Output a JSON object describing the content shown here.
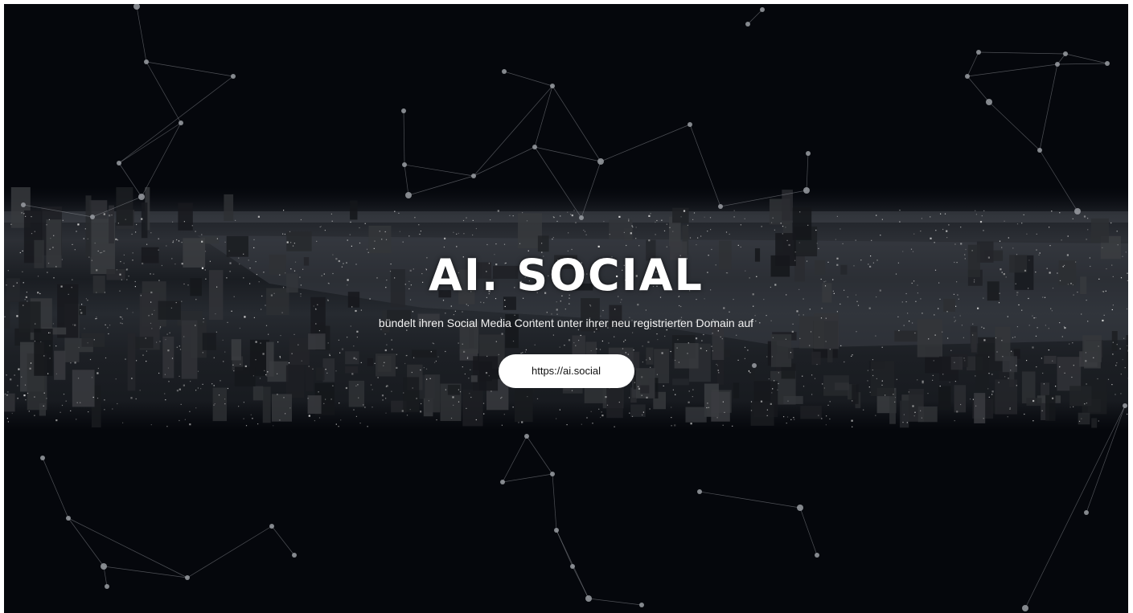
{
  "hero": {
    "title": "AI. SOCIAL",
    "subtitle": "bündelt ihren Social Media Content unter ihrer neu registrierten Domain auf",
    "cta_label": "https://ai.social"
  },
  "colors": {
    "background": "#05070c",
    "button_bg": "#ffffff",
    "button_text": "#111111",
    "text": "#ffffff"
  }
}
